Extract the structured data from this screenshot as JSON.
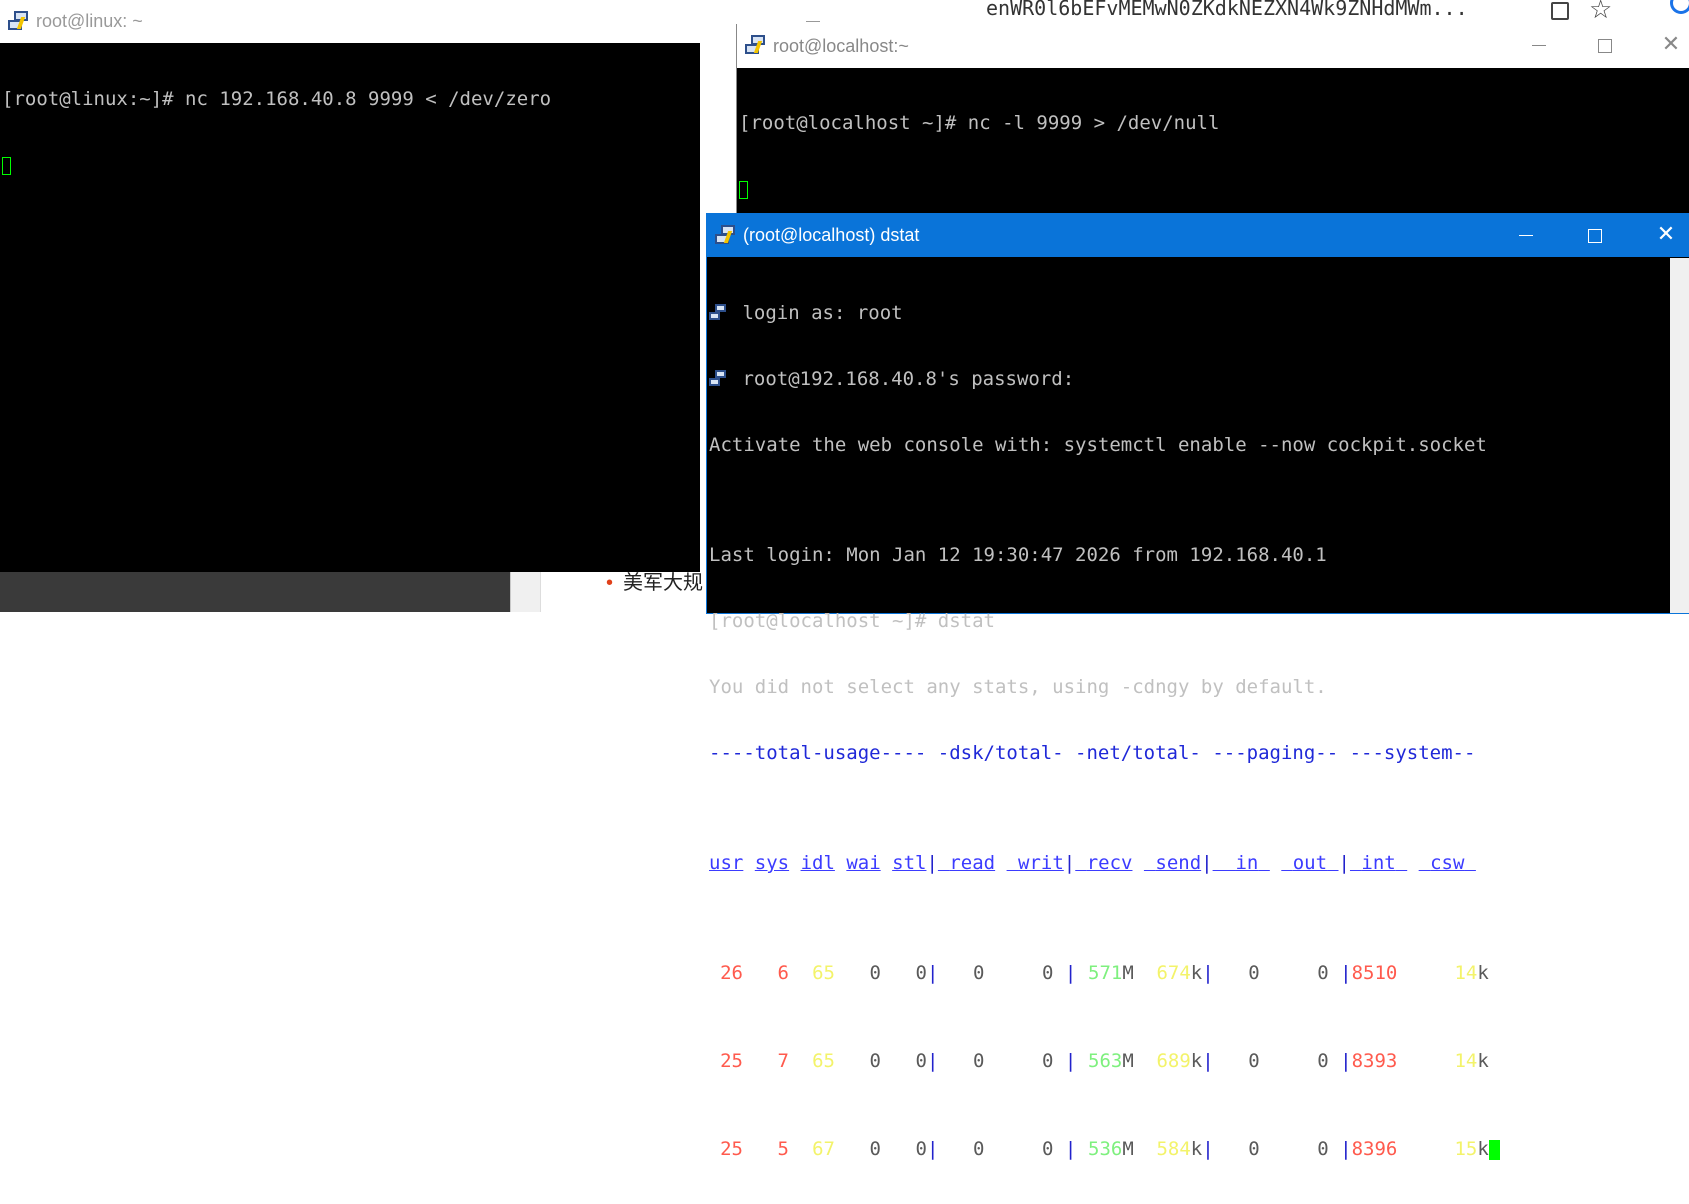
{
  "background": {
    "browser_url_fragment": "enWR0l6bEFvMEMwN0ZKdkNEZXN4Wk9ZNHdMWm...",
    "list_item_text": "美军大规"
  },
  "win_linux": {
    "title": "root@linux: ~",
    "lines": [
      "[root@linux:~]# nc 192.168.40.8 9999 < /dev/zero"
    ]
  },
  "win_local": {
    "title": "root@localhost:~",
    "lines": [
      "[root@localhost ~]# nc -l 9999 > /dev/null"
    ]
  },
  "win_dstat": {
    "title": "(root@localhost) dstat",
    "login_line": "login as: root",
    "password_line": "root@192.168.40.8's password:",
    "lines": [
      "Activate the web console with: systemctl enable --now cockpit.socket",
      "",
      "Last login: Mon Jan 12 19:30:47 2026 from 192.168.40.1",
      "[root@localhost ~]# dstat",
      "You did not select any stats, using -cdngy by default."
    ],
    "group_header": "----total-usage---- -dsk/total- -net/total- ---paging-- ---system--",
    "column_headers": [
      "usr",
      "sys",
      "idl",
      "wai",
      "stl",
      "read",
      "writ",
      "recv",
      "send",
      "in",
      "out",
      "int",
      "csw"
    ],
    "rows": [
      {
        "usr": "26",
        "sys": "6",
        "idl": "65",
        "wai": "0",
        "stl": "0",
        "read": "0",
        "writ": "0",
        "recv": "571",
        "recv_unit": "M",
        "send": "674",
        "send_unit": "k",
        "in": "0",
        "out": "0",
        "int": "8510",
        "csw": "14",
        "csw_unit": "k"
      },
      {
        "usr": "25",
        "sys": "7",
        "idl": "65",
        "wai": "0",
        "stl": "0",
        "read": "0",
        "writ": "0",
        "recv": "563",
        "recv_unit": "M",
        "send": "689",
        "send_unit": "k",
        "in": "0",
        "out": "0",
        "int": "8393",
        "csw": "14",
        "csw_unit": "k"
      },
      {
        "usr": "25",
        "sys": "5",
        "idl": "67",
        "wai": "0",
        "stl": "0",
        "read": "0",
        "writ": "0",
        "recv": "536",
        "recv_unit": "M",
        "send": "584",
        "send_unit": "k",
        "in": "0",
        "out": "0",
        "int": "8396",
        "csw": "15",
        "csw_unit": "k"
      }
    ]
  },
  "colors": {
    "active_titlebar": "#0a74d9",
    "cursor": "#00ff00",
    "usr": "#ff5a4d",
    "idl": "#f3f36a",
    "recv": "#7ef07e"
  }
}
